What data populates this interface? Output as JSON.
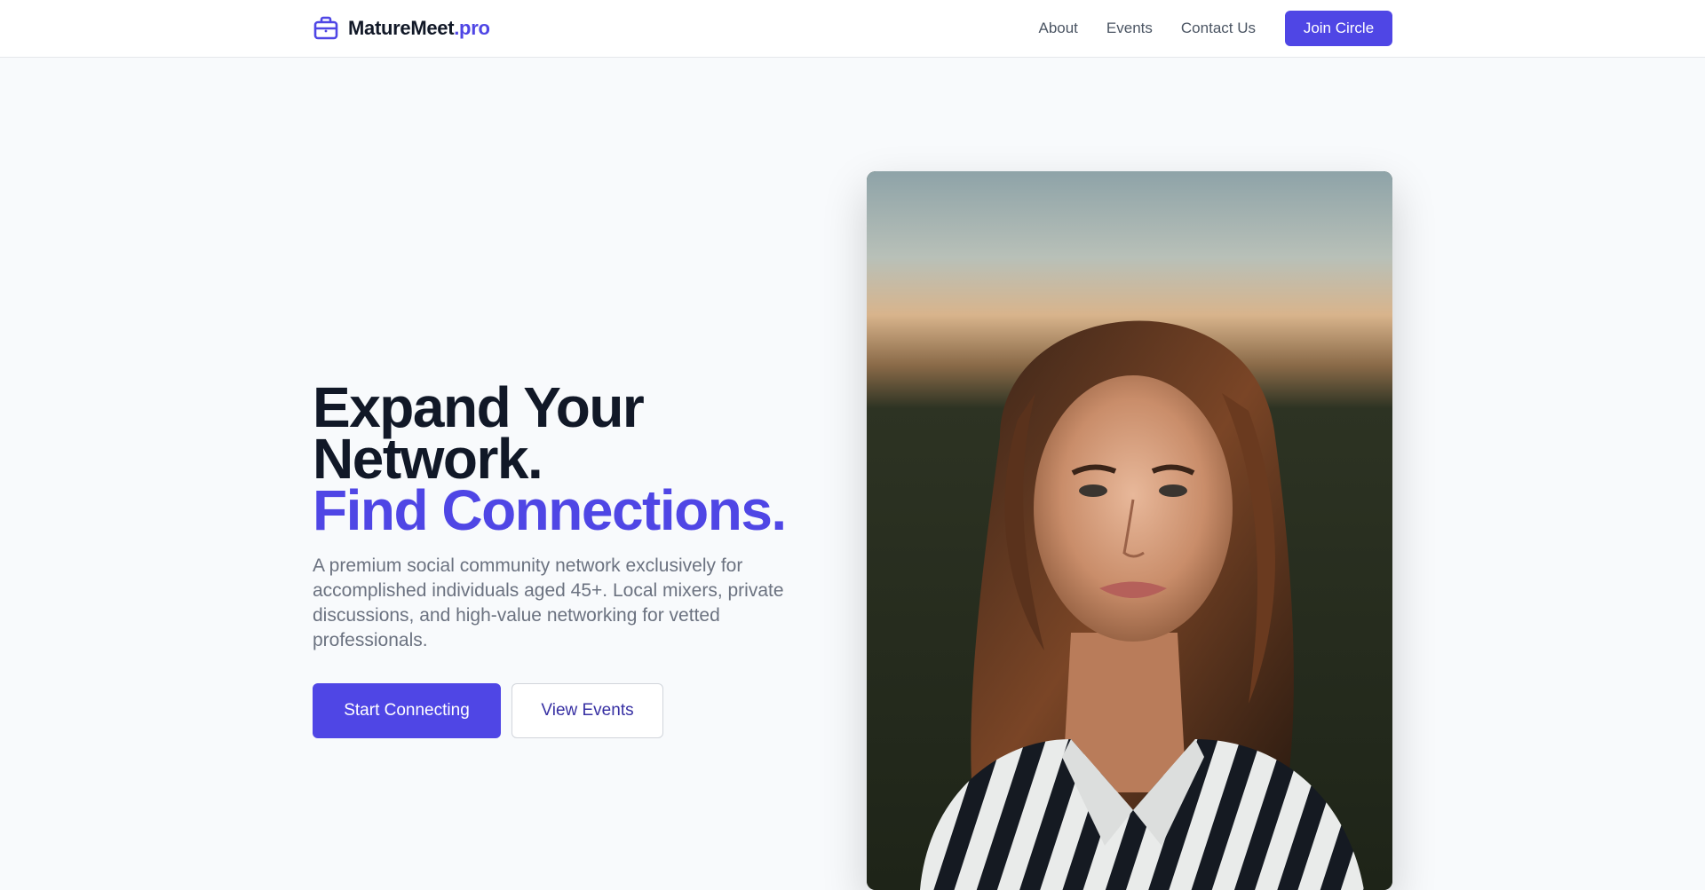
{
  "brand": {
    "name": "MatureMeet",
    "tld": ".pro",
    "icon": "briefcase-icon",
    "accent_color": "#4f46e5"
  },
  "nav": {
    "links": [
      {
        "label": "About"
      },
      {
        "label": "Events"
      },
      {
        "label": "Contact Us"
      }
    ],
    "cta_label": "Join Circle"
  },
  "hero": {
    "title_line1": "Expand Your",
    "title_line2": "Network.",
    "title_accent": "Find Connections.",
    "description": "A premium social community network exclusively for accomplished individuals aged 45+. Local mixers, private discussions, and high-value networking for vetted professionals.",
    "primary_button": "Start Connecting",
    "secondary_button": "View Events"
  }
}
